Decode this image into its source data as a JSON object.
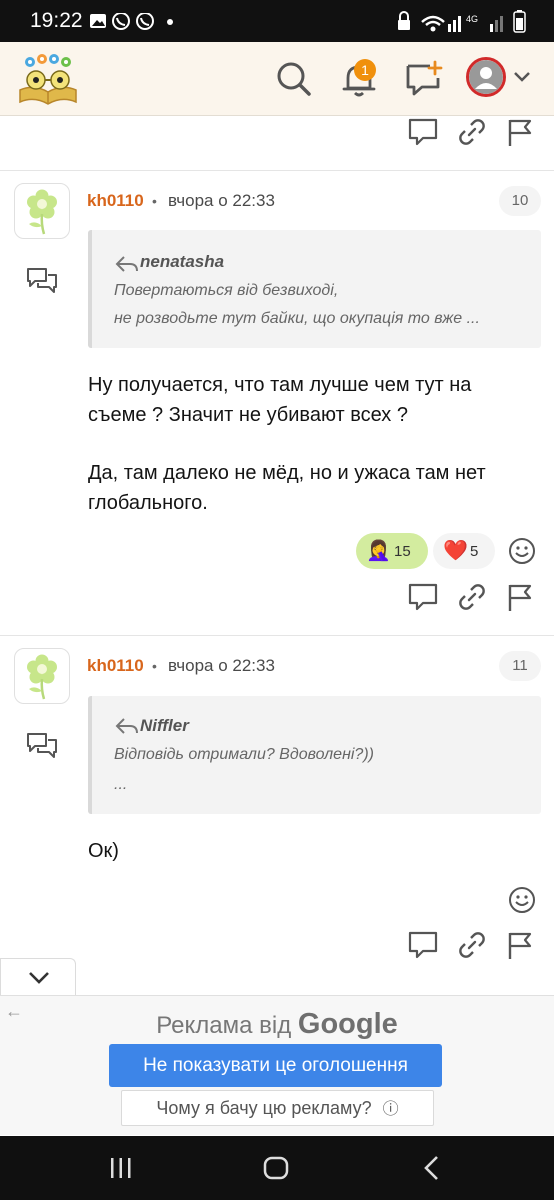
{
  "status_bar": {
    "time": "19:22",
    "left_icons": [
      "image-icon",
      "viber-icon",
      "viber-icon",
      "dot"
    ],
    "right_icons": [
      "lock-icon",
      "wifi-icon",
      "signal-icon",
      "4g",
      "signal-icon",
      "battery-icon"
    ],
    "network": "4G"
  },
  "header": {
    "logo": "book-with-flowers-logo",
    "notifications_count": "1",
    "icons": [
      "search-icon",
      "bell-icon",
      "new-message-icon",
      "avatar",
      "chevron-down-icon"
    ]
  },
  "posts": [
    {
      "author": "kh0110",
      "separator": "•",
      "date": "вчора о 22:33",
      "number": "10",
      "quote": {
        "author": "nenatasha",
        "lines": [
          "Повертаються від безвиході,",
          "не розводьте тут байки, що окупація то вже ..."
        ]
      },
      "body": [
        "Ну получается, что там лучше чем тут на",
        "съеме ? Значит не убивают всех ?",
        "",
        "Да, там далеко не мёд, но и ужаса там нет",
        "глобального."
      ],
      "reactions": [
        {
          "emoji": "🤦‍♀️",
          "count": "15"
        },
        {
          "emoji": "❤️",
          "count": "5"
        }
      ]
    },
    {
      "author": "kh0110",
      "separator": "•",
      "date": "вчора о 22:33",
      "number": "11",
      "quote": {
        "author": "Niffler",
        "lines": [
          "Відповідь отримали? Вдоволені?))",
          "..."
        ]
      },
      "body": [
        "Ок)"
      ],
      "reactions": []
    }
  ],
  "ad": {
    "back_arrow": "←",
    "label": "Реклама від",
    "brand": "Google",
    "hide_button": "Не показувати це оголошення",
    "why_button": "Чому я бачу цю рекламу?",
    "info_icon": "ⓘ"
  },
  "colors": {
    "header_bg": "#fbf5ec",
    "author": "#d8661c",
    "badge": "#f0900c",
    "ad_button": "#3d85e8",
    "reaction_active": "#d3ec9f"
  }
}
